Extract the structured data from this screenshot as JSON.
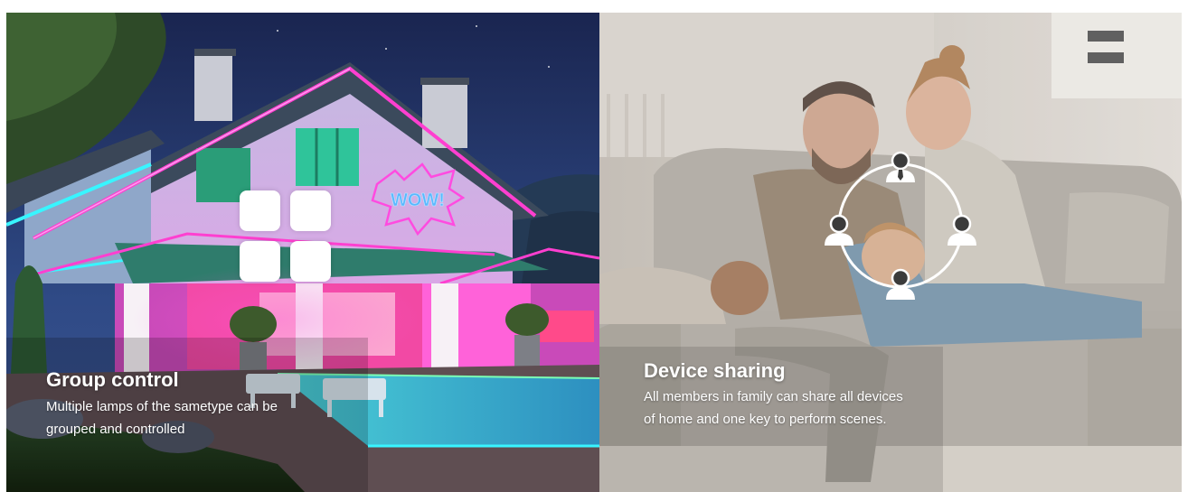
{
  "panels": {
    "group": {
      "title": "Group control",
      "description": "Multiple lamps of the sametype can be grouped and controlled",
      "icon": "grid-icon",
      "sign_text": "WOW!"
    },
    "sharing": {
      "title": "Device sharing",
      "description": "All members in family can share all devices of home and one key to perform scenes.",
      "icon": "user-share-circle-icon"
    }
  },
  "colors": {
    "neon_pink": "#ff3fd0",
    "neon_cyan": "#38f5ff",
    "text": "#ffffff"
  }
}
